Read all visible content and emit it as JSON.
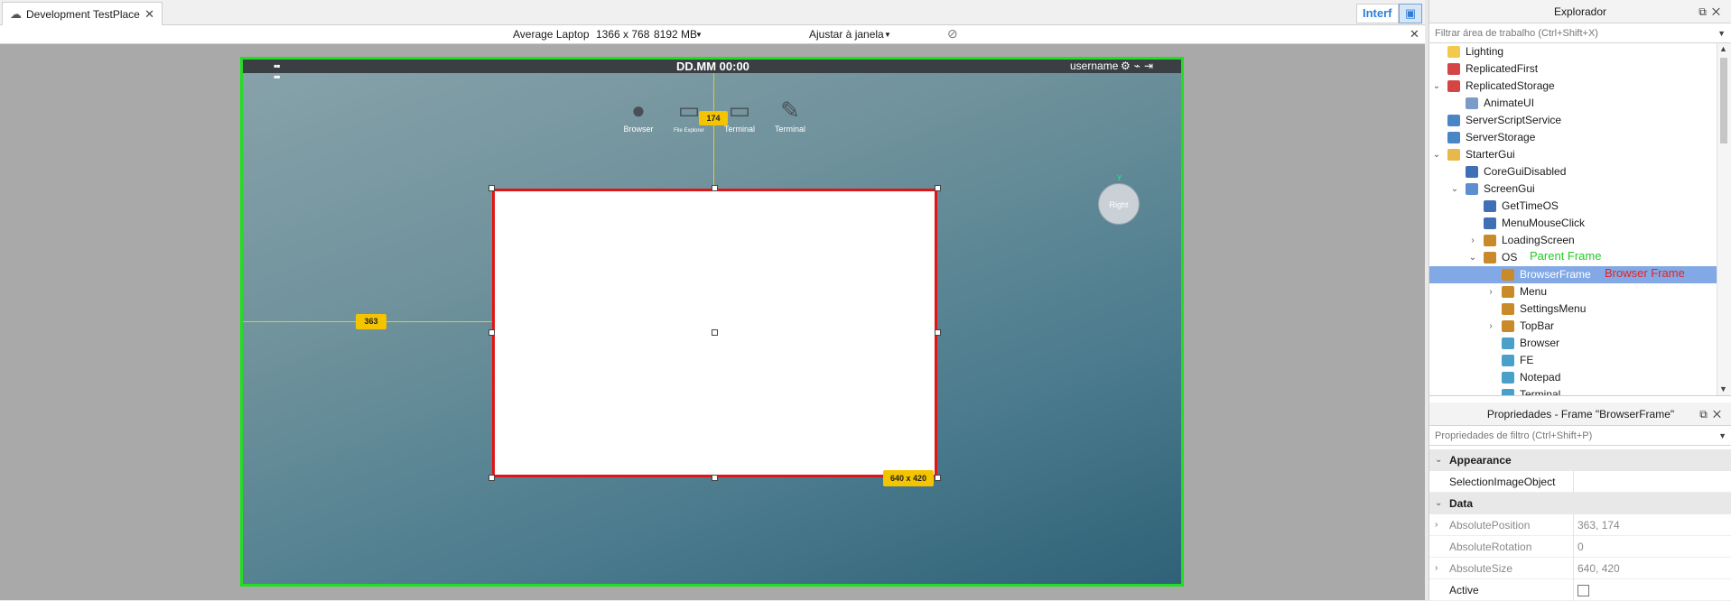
{
  "tab": {
    "label": "Development TestPlace",
    "close": "✕",
    "icon": "cloud-icon"
  },
  "toolbar": {
    "interf_label": "Interf",
    "layout_icon": "layout-icon"
  },
  "device": {
    "name": "Average Laptop",
    "resolution": "1366 x 768",
    "memory": "8192 MB",
    "fit": "Ajustar à janela",
    "close": "✕"
  },
  "game": {
    "clock": "DD.MM  00:00",
    "username": "username",
    "desktop_icons": [
      {
        "label": "Browser",
        "icon": "globe-icon"
      },
      {
        "label": "File Explorer",
        "icon": "folder-icon"
      },
      {
        "label": "Terminal",
        "icon": "terminal-icon"
      },
      {
        "label": "Terminal",
        "icon": "notepad-icon"
      }
    ],
    "offset_y": "174",
    "offset_x": "363",
    "size_badge": "640 x 420",
    "widget_label": "Right",
    "widget_axis": "Y"
  },
  "explorer": {
    "title": "Explorador",
    "filter_placeholder": "Filtrar área de trabalho (Ctrl+Shift+X)",
    "items": [
      {
        "label": "Lighting",
        "icon": "bulb",
        "depth": 1,
        "exp": ""
      },
      {
        "label": "ReplicatedFirst",
        "icon": "replicated",
        "depth": 1,
        "exp": ""
      },
      {
        "label": "ReplicatedStorage",
        "icon": "replicated",
        "depth": 1,
        "exp": "v"
      },
      {
        "label": "AnimateUI",
        "icon": "script",
        "depth": 2,
        "exp": ""
      },
      {
        "label": "ServerScriptService",
        "icon": "service",
        "depth": 1,
        "exp": ""
      },
      {
        "label": "ServerStorage",
        "icon": "service",
        "depth": 1,
        "exp": ""
      },
      {
        "label": "StarterGui",
        "icon": "folder",
        "depth": 1,
        "exp": "v"
      },
      {
        "label": "CoreGuiDisabled",
        "icon": "localscript",
        "depth": 2,
        "exp": ""
      },
      {
        "label": "ScreenGui",
        "icon": "screengui",
        "depth": 2,
        "exp": "v"
      },
      {
        "label": "GetTimeOS",
        "icon": "localscript",
        "depth": 3,
        "exp": ""
      },
      {
        "label": "MenuMouseClick",
        "icon": "localscript",
        "depth": 3,
        "exp": ""
      },
      {
        "label": "LoadingScreen",
        "icon": "frame",
        "depth": 3,
        "exp": ">"
      },
      {
        "label": "OS",
        "icon": "frame",
        "depth": 3,
        "exp": "v"
      },
      {
        "label": "BrowserFrame",
        "icon": "frame",
        "depth": 4,
        "exp": ""
      },
      {
        "label": "Menu",
        "icon": "frame",
        "depth": 4,
        "exp": ">"
      },
      {
        "label": "SettingsMenu",
        "icon": "frame",
        "depth": 4,
        "exp": ""
      },
      {
        "label": "TopBar",
        "icon": "frame",
        "depth": 4,
        "exp": ">"
      },
      {
        "label": "Browser",
        "icon": "image",
        "depth": 4,
        "exp": ""
      },
      {
        "label": "FE",
        "icon": "image",
        "depth": 4,
        "exp": ""
      },
      {
        "label": "Notepad",
        "icon": "image",
        "depth": 4,
        "exp": ""
      },
      {
        "label": "Terminal",
        "icon": "image",
        "depth": 4,
        "exp": ""
      }
    ],
    "selected_label": "BrowserFrame",
    "note_parent": "Parent Frame",
    "note_browser": "Browser Frame"
  },
  "properties": {
    "title": "Propriedades - Frame \"BrowserFrame\"",
    "filter_placeholder": "Propriedades de filtro (Ctrl+Shift+P)",
    "sections": [
      {
        "name": "Appearance",
        "rows": [
          {
            "name": "SelectionImageObject",
            "value": "",
            "expandable": false
          }
        ]
      },
      {
        "name": "Data",
        "rows": [
          {
            "name": "AbsolutePosition",
            "value": "363, 174",
            "expandable": true
          },
          {
            "name": "AbsoluteRotation",
            "value": "0",
            "expandable": false
          },
          {
            "name": "AbsoluteSize",
            "value": "640, 420",
            "expandable": true
          },
          {
            "name": "Active",
            "value": "",
            "expandable": false,
            "checkbox": true
          }
        ]
      }
    ]
  },
  "colors": {
    "accent": "#2f7fd7",
    "selection": "#82a9e6",
    "frame_border": "#e01515",
    "screen_border": "#22dd22",
    "guide": "#f5c400"
  }
}
